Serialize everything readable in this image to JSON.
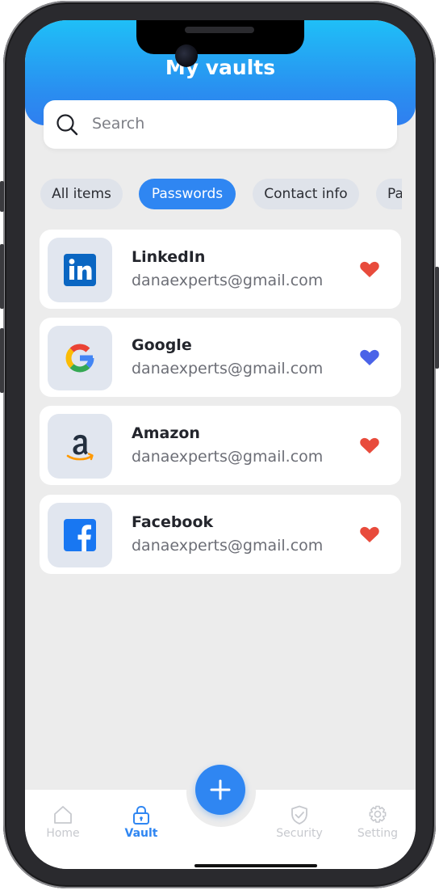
{
  "header": {
    "title": "My vaults"
  },
  "search": {
    "placeholder": "Search"
  },
  "filters": [
    {
      "label": "All items",
      "active": false
    },
    {
      "label": "Passwords",
      "active": true
    },
    {
      "label": "Contact info",
      "active": false
    },
    {
      "label": "Pa",
      "active": false
    }
  ],
  "items": [
    {
      "name": "LinkedIn",
      "email": "danaexperts@gmail.com",
      "icon": "linkedin-logo-icon",
      "heart_color": "#e84b3c"
    },
    {
      "name": "Google",
      "email": "danaexperts@gmail.com",
      "icon": "google-logo-icon",
      "heart_color": "#4a63e8"
    },
    {
      "name": "Amazon",
      "email": "danaexperts@gmail.com",
      "icon": "amazon-logo-icon",
      "heart_color": "#e84b3c"
    },
    {
      "name": "Facebook",
      "email": "danaexperts@gmail.com",
      "icon": "facebook-logo-icon",
      "heart_color": "#e84b3c"
    }
  ],
  "nav": {
    "home": "Home",
    "vault": "Vault",
    "security": "Security",
    "setting": "Setting",
    "active": "vault"
  },
  "colors": {
    "accent": "#2f86f2",
    "header_top": "#1fbff7",
    "header_bottom": "#2f7ff0"
  }
}
